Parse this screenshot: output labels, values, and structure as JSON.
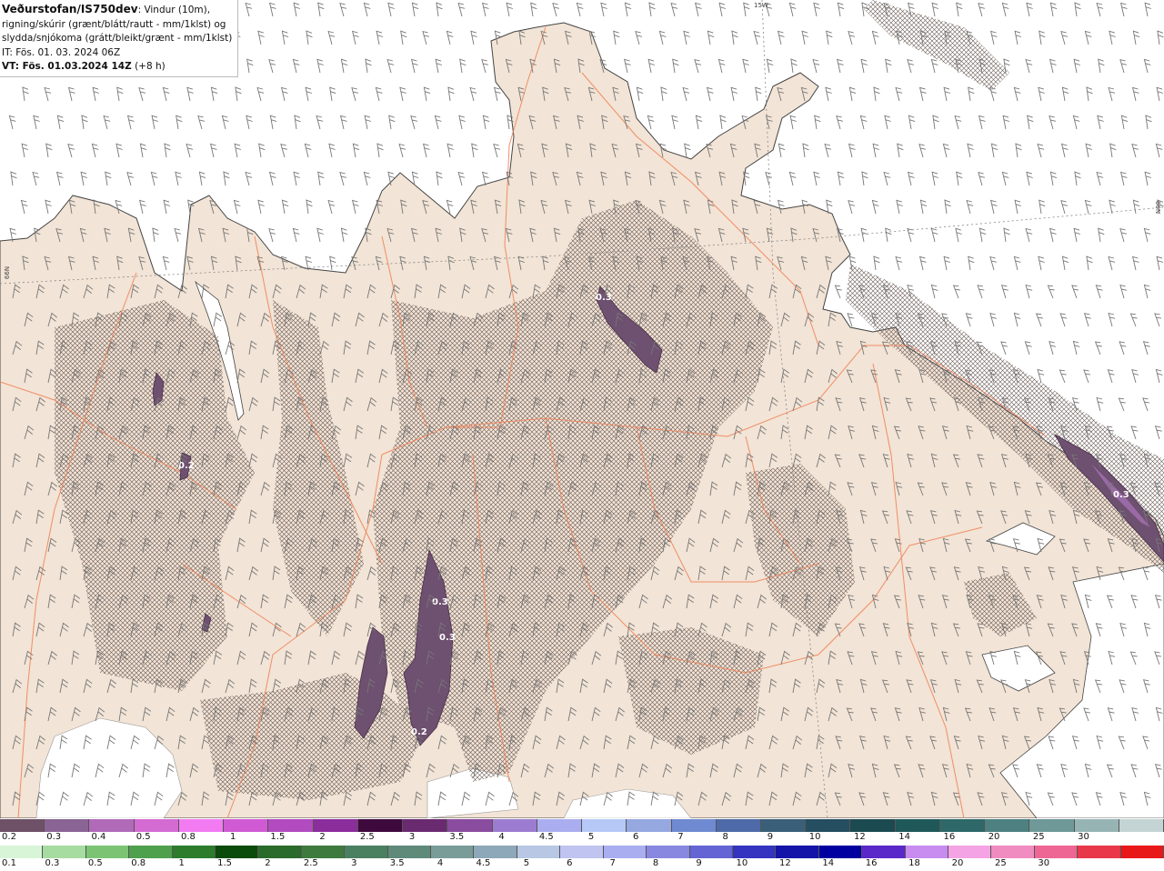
{
  "header": {
    "title": "Veðurstofan/IS750dev",
    "line1_rest": ": Vindur (10m),",
    "line2": "rigning/skúrir (grænt/blátt/rautt - mm/1klst) og",
    "line3": "slydda/snjókoma (grátt/bleikt/grænt - mm/1klst)",
    "it": "IT: Fös. 01. 03. 2024 06Z",
    "vt_bold": "VT: Fös. 01.03.2024 14Z",
    "vt_rest": " (+8 h)"
  },
  "grid_labels": {
    "lon": "15W",
    "lat_left": "66N",
    "lat_right": "66N"
  },
  "contour_labels": [
    "0.3",
    "0.2",
    "0.3",
    "0.3",
    "0.2",
    "0.3"
  ],
  "legend_top": {
    "labels": [
      "0.2",
      "0.3",
      "0.4",
      "0.5",
      "0.8",
      "1",
      "1.5",
      "2",
      "2.5",
      "3",
      "3.5",
      "4",
      "4.5",
      "5",
      "6",
      "7",
      "8",
      "9",
      "10",
      "12",
      "14",
      "16",
      "20",
      "25",
      "30"
    ],
    "colors": [
      "#6e5166",
      "#8a6494",
      "#b06ab8",
      "#d46bd3",
      "#f27bf2",
      "#d05ad4",
      "#b24ac0",
      "#8c2d9c",
      "#3e0a3e",
      "#6a2a70",
      "#8a4c9e",
      "#9c7cd0",
      "#aaaef0",
      "#b6c8f5",
      "#95a8e0",
      "#6f8ad0",
      "#4f6aa8",
      "#3a5f78",
      "#254e60",
      "#1b4a50",
      "#1f5858",
      "#2e6868",
      "#4d8080",
      "#6f9898",
      "#97b4b4",
      "#c4d4d4"
    ]
  },
  "legend_bottom": {
    "labels": [
      "0.1",
      "0.3",
      "0.5",
      "0.8",
      "1",
      "1.5",
      "2",
      "2.5",
      "3",
      "3.5",
      "4",
      "4.5",
      "5",
      "6",
      "7",
      "8",
      "9",
      "10",
      "12",
      "14",
      "16",
      "18",
      "20",
      "25",
      "30"
    ],
    "colors": [
      "#d8f5d8",
      "#a6dca0",
      "#7cc474",
      "#4fa04c",
      "#2c7c2c",
      "#0a4a0a",
      "#2a6a2a",
      "#3e7a3e",
      "#4a8060",
      "#5f8a7a",
      "#7a9c98",
      "#8da8b8",
      "#b8c8e4",
      "#c0c4f0",
      "#a8aef0",
      "#8888e0",
      "#6464d4",
      "#3434c0",
      "#1414a8",
      "#0000a0",
      "#5a28c8",
      "#c88cf0",
      "#f4a4e4",
      "#f08cc0",
      "#ee6694",
      "#e8384a",
      "#e81818"
    ]
  }
}
